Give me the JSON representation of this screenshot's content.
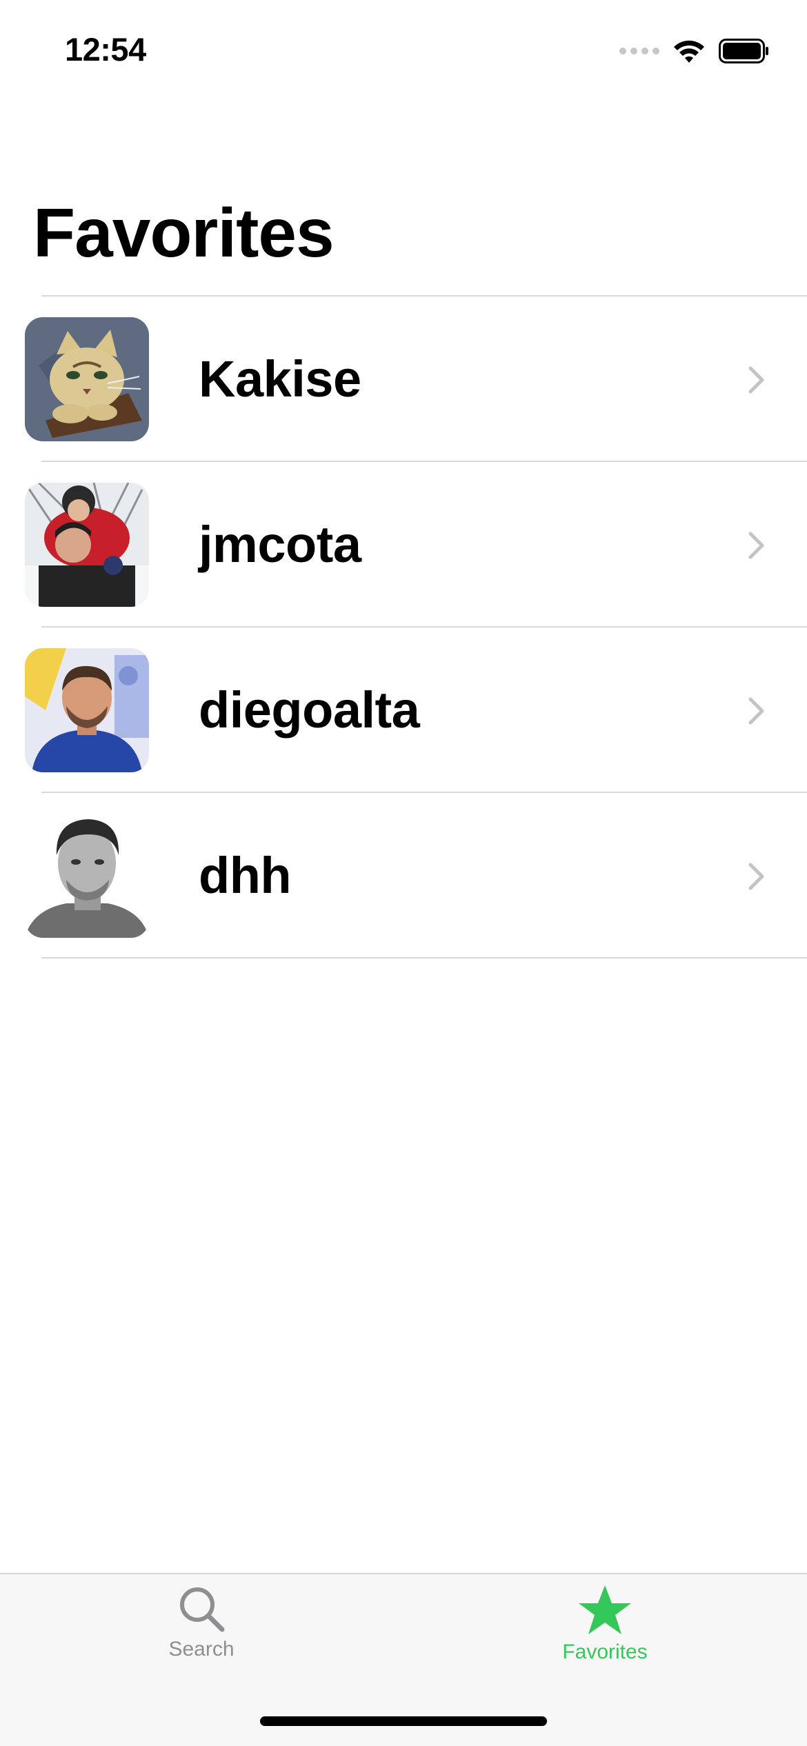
{
  "status_bar": {
    "time": "12:54"
  },
  "page": {
    "title": "Favorites"
  },
  "favorites": [
    {
      "name": "Kakise",
      "avatar": "cat-avatar"
    },
    {
      "name": "jmcota",
      "avatar": "photo-avatar"
    },
    {
      "name": "diegoalta",
      "avatar": "photo-avatar"
    },
    {
      "name": "dhh",
      "avatar": "photo-avatar"
    }
  ],
  "tab_bar": {
    "tabs": [
      {
        "label": "Search",
        "icon": "search-icon",
        "selected": false
      },
      {
        "label": "Favorites",
        "icon": "star-icon",
        "selected": true
      }
    ]
  },
  "colors": {
    "accent": "#34c759",
    "inactive_tab": "#8e8e93",
    "separator": "#d8d8dc",
    "chevron": "#c4c4c7"
  }
}
